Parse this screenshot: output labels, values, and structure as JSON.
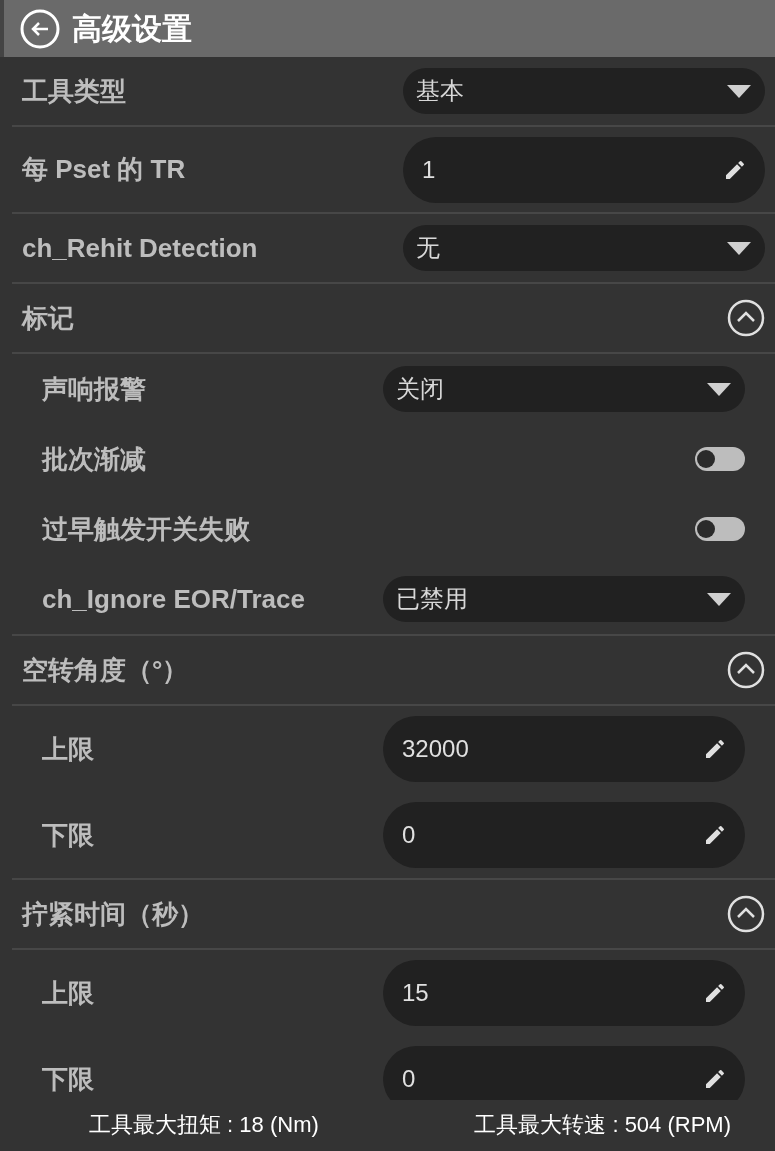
{
  "header": {
    "title": "高级设置"
  },
  "rows": [
    {
      "kind": "select",
      "label": "工具类型",
      "value": "基本"
    },
    {
      "kind": "input",
      "label": "**每** Pset **的** TR",
      "value": "1"
    },
    {
      "kind": "select",
      "label": "ch_Rehit Detection",
      "value": "无"
    },
    {
      "kind": "section",
      "label": "标记",
      "expanded": true,
      "children": [
        {
          "kind": "select",
          "label": "声响报警",
          "value": "关闭"
        },
        {
          "kind": "toggle",
          "label": "批次渐减",
          "checked": false
        },
        {
          "kind": "toggle",
          "label": "过早触发开关失败",
          "checked": false
        },
        {
          "kind": "select",
          "label": "ch_Ignore EOR/Trace",
          "value": "已禁用"
        }
      ]
    },
    {
      "kind": "section",
      "label": "空转角度（°）",
      "expanded": true,
      "children": [
        {
          "kind": "input",
          "label": "上限",
          "value": "32000"
        },
        {
          "kind": "input",
          "label": "下限",
          "value": "0"
        }
      ]
    },
    {
      "kind": "section",
      "label": "拧紧时间（秒）",
      "expanded": true,
      "children": [
        {
          "kind": "input",
          "label": "上限",
          "value": "15"
        },
        {
          "kind": "input",
          "label": "下限",
          "value": "0"
        }
      ]
    }
  ],
  "footer": {
    "left": "工具最大扭矩 : 18 (Nm)",
    "right": "工具最大转速 : 504 (RPM)"
  }
}
